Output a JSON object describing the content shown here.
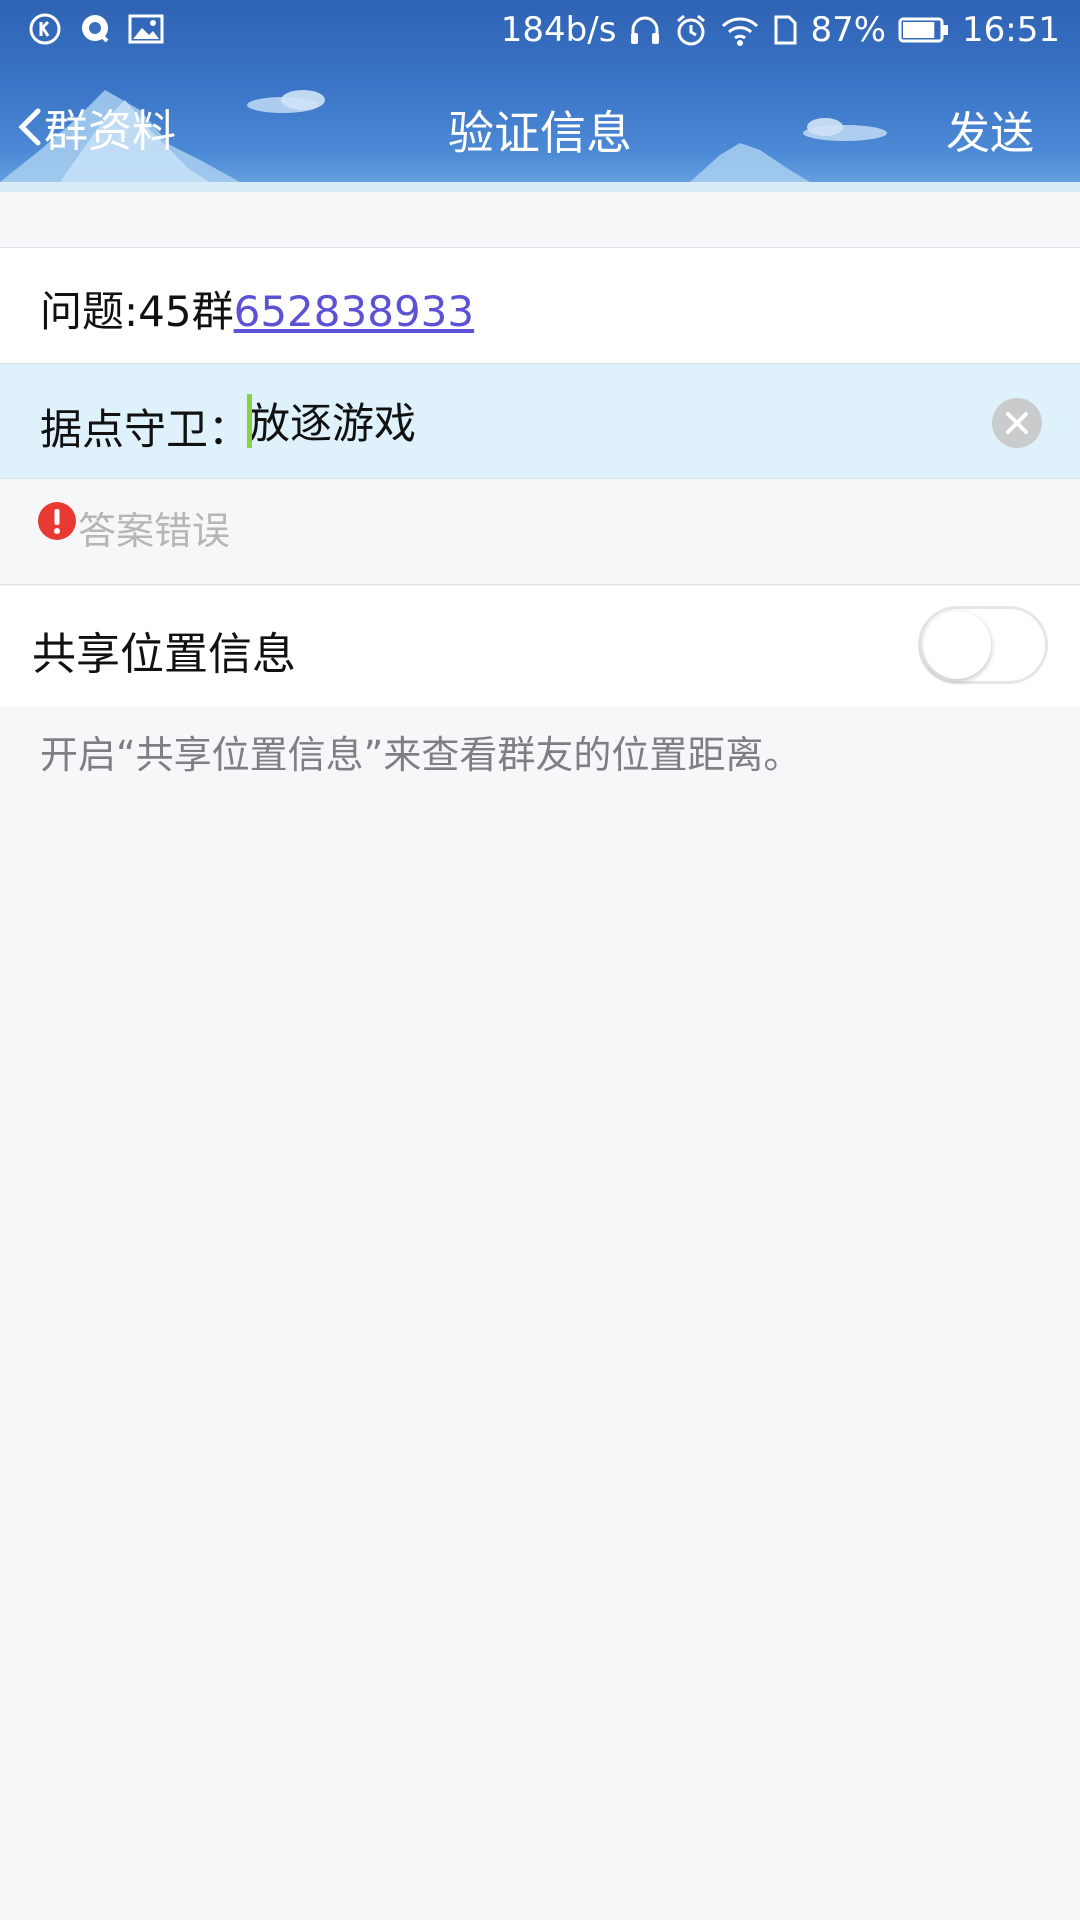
{
  "status_bar": {
    "network_speed": "184b/s",
    "battery_percent": "87%",
    "battery_level": 0.87,
    "time": "16:51",
    "left_icons": [
      "k-icon",
      "q-icon",
      "gallery-icon"
    ],
    "right_icons": [
      "headphone-icon",
      "alarm-icon",
      "wifi-icon",
      "sim-icon",
      "battery-icon"
    ]
  },
  "nav": {
    "back_label": "群资料",
    "title": "验证信息",
    "send_label": "发送"
  },
  "question": {
    "prefix": "问题:45群",
    "link": "652838933"
  },
  "answer": {
    "label": "据点守卫：",
    "value": "放逐游戏"
  },
  "error": {
    "text": "答案错误"
  },
  "share_location": {
    "label": "共享位置信息",
    "enabled": false,
    "hint": "开启“共享位置信息”来查看群友的位置距离。"
  },
  "colors": {
    "header": "#3b74c6",
    "link": "#5b52d6",
    "error": "#e83a32",
    "caret": "#8bd045",
    "answer_bg": "#dff1fa"
  }
}
